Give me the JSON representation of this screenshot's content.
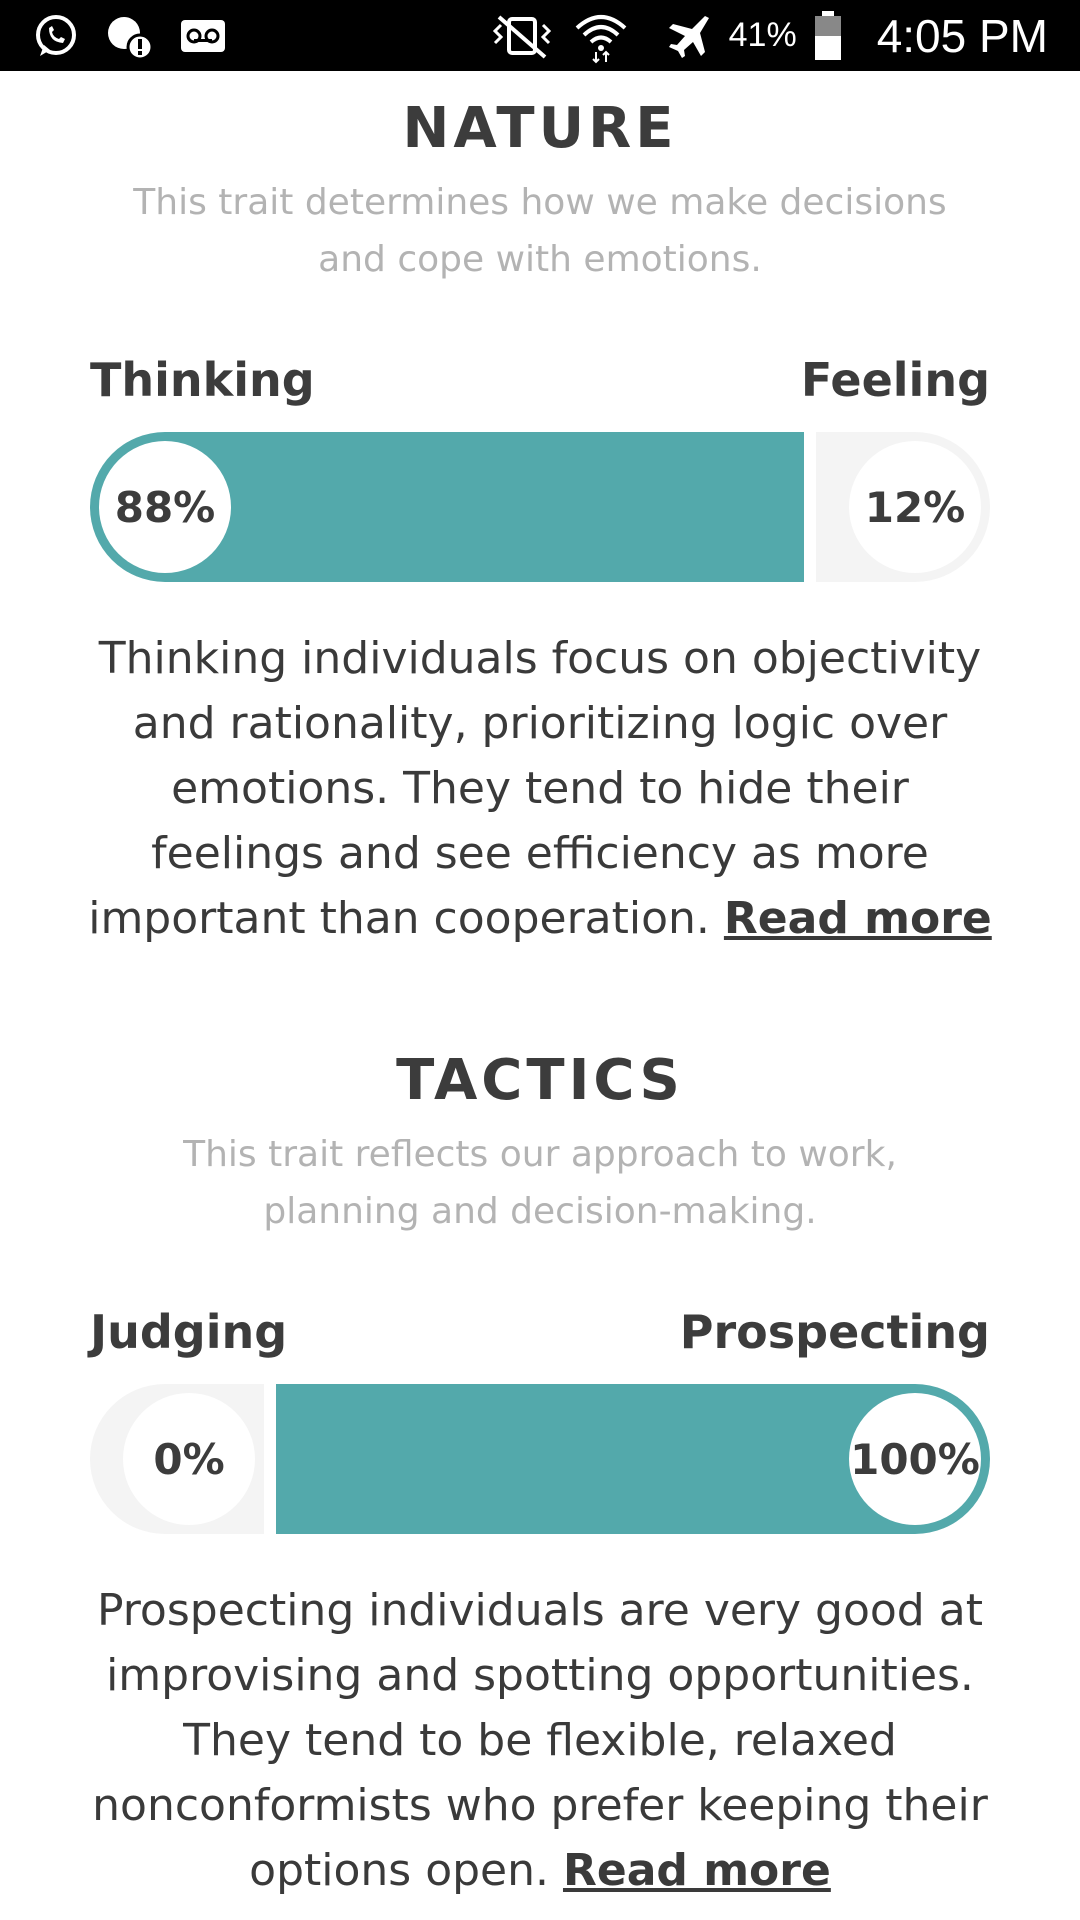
{
  "status_bar": {
    "battery": "41%",
    "time": "4:05 PM",
    "icons": [
      "whatsapp-icon",
      "alert-notification-icon",
      "voicemail-icon",
      "vibrate-mute-icon",
      "wifi-icon",
      "airplane-mode-icon",
      "battery-icon"
    ]
  },
  "sections": [
    {
      "title": "NATURE",
      "subtitle": "This trait determines how we make decisions and cope with emotions.",
      "left_label": "Thinking",
      "right_label": "Feeling",
      "left_percent_text": "88%",
      "right_percent_text": "12%",
      "dominant": "left",
      "fill_fraction": 0.88,
      "description": "Thinking individuals focus on objectivity and rationality, prioritizing logic over emotions. They tend to hide their feelings and see efficiency as more important than cooperation.",
      "read_more": "Read more"
    },
    {
      "title": "TACTICS",
      "subtitle": "This trait reflects our approach to work, planning and decision-making.",
      "left_label": "Judging",
      "right_label": "Prospecting",
      "left_percent_text": "0%",
      "right_percent_text": "100%",
      "dominant": "right",
      "fill_fraction": 1.0,
      "description": "Prospecting individuals are very good at improvising and spotting opportunities. They tend to be flexible, relaxed nonconformists who prefer keeping their options open.",
      "read_more": "Read more"
    }
  ],
  "colors": {
    "accent": "#53a9ab",
    "track": "#f4f4f4",
    "title": "#3c3c3c",
    "subtitle": "#b3b3b3",
    "statusbar": "#000000"
  }
}
